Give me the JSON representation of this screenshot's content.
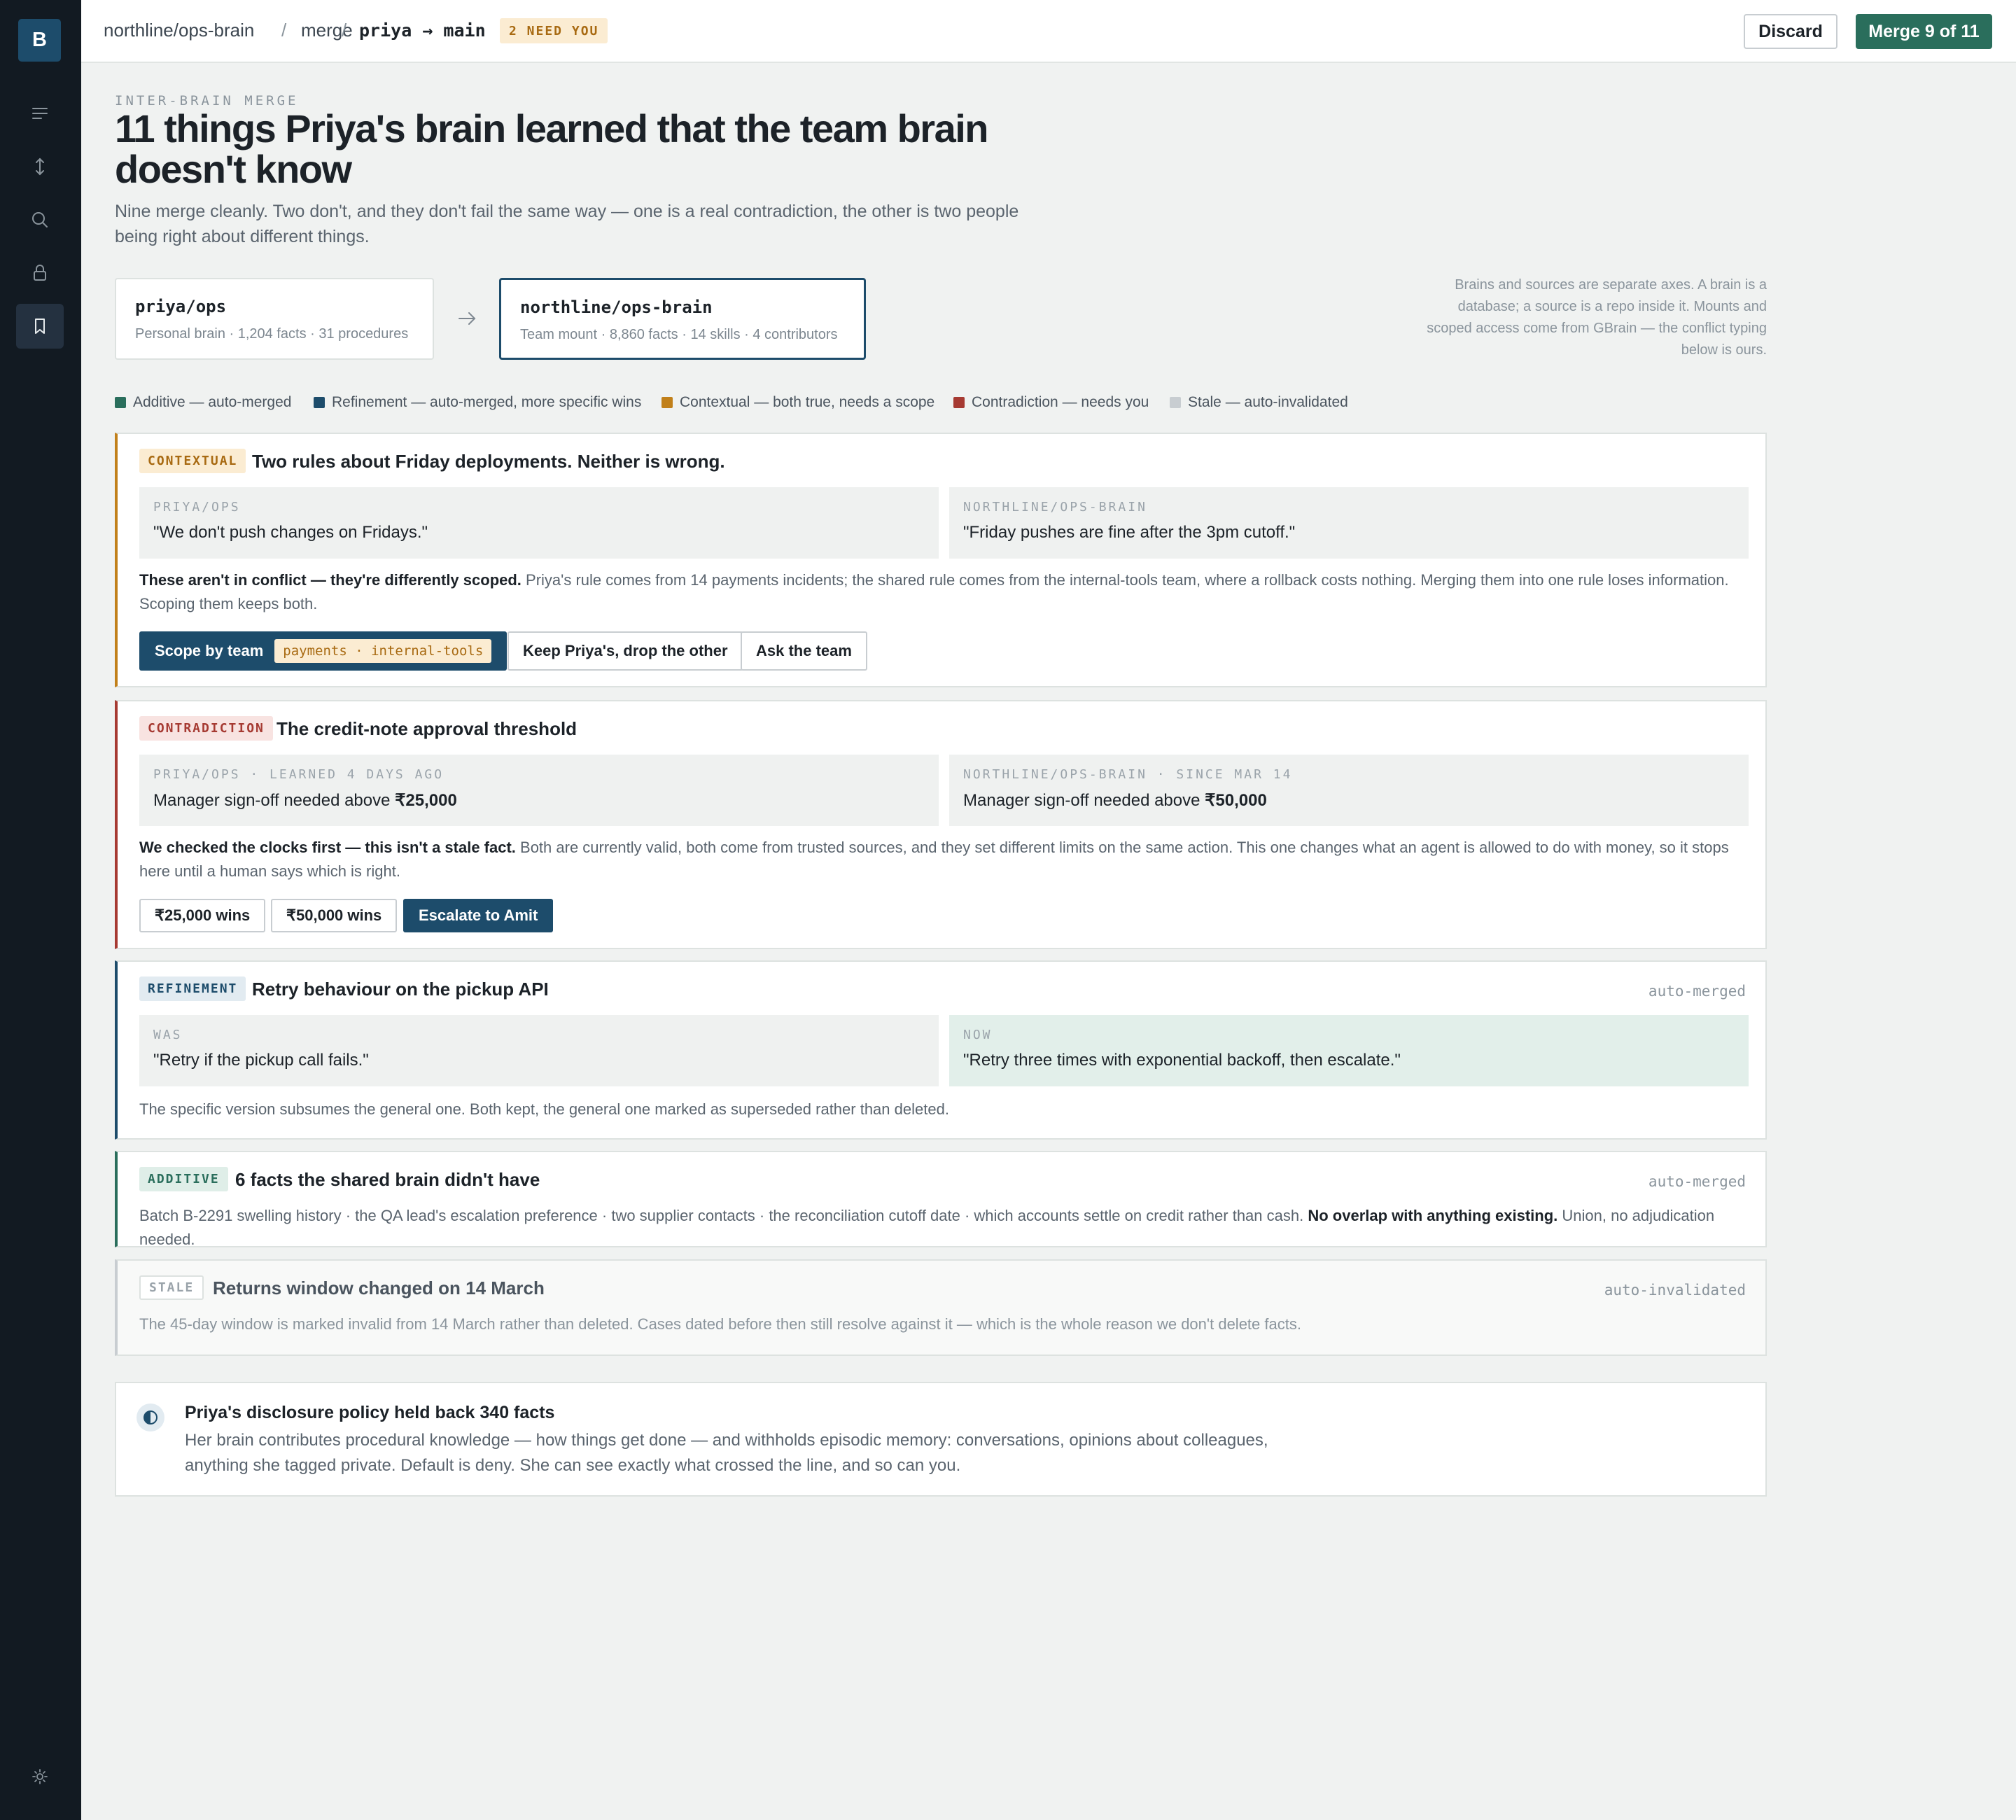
{
  "app": {
    "logo_letter": "B"
  },
  "sidebar": {
    "items": [
      {
        "icon": "list-icon",
        "active": false
      },
      {
        "icon": "merge-arrows-icon",
        "active": false
      },
      {
        "icon": "search-icon",
        "active": false
      },
      {
        "icon": "lock-icon",
        "active": false
      },
      {
        "icon": "bookmark-icon",
        "active": true
      }
    ],
    "footer_icon": "settings-sun-icon"
  },
  "topbar": {
    "breadcrumb": [
      "northline/ops-brain",
      "merge"
    ],
    "separator": "/",
    "branch": "priya → main",
    "badge": "2 NEED YOU",
    "discard_label": "Discard",
    "merge_label": "Merge 9 of 11"
  },
  "header": {
    "eyebrow": "INTER-BRAIN MERGE",
    "title": "11 things Priya's brain learned that the team brain doesn't know",
    "subtitle": "Nine merge cleanly. Two don't, and they don't fail the same way — one is a real contradiction, the other is two people being right about different things."
  },
  "brains": {
    "source": {
      "name": "priya/ops",
      "meta": "Personal brain · 1,204 facts · 31 procedures"
    },
    "target": {
      "name": "northline/ops-brain",
      "meta": "Team mount · 8,860 facts · 14 skills · 4 contributors"
    },
    "note": "Brains and sources are separate axes. A brain is a database; a source is a repo inside it. Mounts and scoped access come from GBrain — the conflict typing below is ours."
  },
  "legend": [
    {
      "label": "Additive — auto-merged",
      "color": "#2a6e5c"
    },
    {
      "label": "Refinement — auto-merged, more specific wins",
      "color": "#1d4c6b"
    },
    {
      "label": "Contextual — both true, needs a scope",
      "color": "#c1801a"
    },
    {
      "label": "Contradiction — needs you",
      "color": "#a63a32"
    },
    {
      "label": "Stale — auto-invalidated",
      "color": "#c8cdd1"
    }
  ],
  "cards": {
    "contextual": {
      "tag": "CONTEXTUAL",
      "title": "Two rules about Friday deployments. Neither is wrong.",
      "left_label": "PRIYA/OPS",
      "left_text": "\"We don't push changes on Fridays.\"",
      "right_label": "NORTHLINE/OPS-BRAIN",
      "right_text": "\"Friday pushes are fine after the 3pm cutoff.\"",
      "body_strong": "These aren't in conflict — they're differently scoped.",
      "body": " Priya's rule comes from 14 payments incidents; the shared rule comes from the internal-tools team, where a rollback costs nothing. Merging them into one rule loses information. Scoping them keeps both.",
      "action_primary": "Scope by team",
      "action_chip": "payments · internal-tools",
      "action_2": "Keep Priya's, drop the other",
      "action_3": "Ask the team"
    },
    "contradiction": {
      "tag": "CONTRADICTION",
      "title": "The credit-note approval threshold",
      "left_label": "PRIYA/OPS · LEARNED 4 DAYS AGO",
      "left_text": "Manager sign-off needed above ",
      "left_value": "₹25,000",
      "right_label": "NORTHLINE/OPS-BRAIN · SINCE MAR 14",
      "right_text": "Manager sign-off needed above ",
      "right_value": "₹50,000",
      "body_strong": "We checked the clocks first — this isn't a stale fact.",
      "body": " Both are currently valid, both come from trusted sources, and they set different limits on the same action. This one changes what an agent is allowed to do with money, so it stops here until a human says which is right.",
      "action_1": "₹25,000 wins",
      "action_2": "₹50,000 wins",
      "action_3": "Escalate to Amit"
    },
    "refinement": {
      "tag": "REFINEMENT",
      "title": "Retry behaviour on the pickup API",
      "status": "auto-merged",
      "left_label": "WAS",
      "left_text": "\"Retry if the pickup call fails.\"",
      "right_label": "NOW",
      "right_text": "\"Retry three times with exponential backoff, then escalate.\"",
      "body": "The specific version subsumes the general one. Both kept, the general one marked as superseded rather than deleted."
    },
    "additive": {
      "tag": "ADDITIVE",
      "title": "6 facts the shared brain didn't have",
      "status": "auto-merged",
      "body": "Batch B-2291 swelling history · the QA lead's escalation preference · two supplier contacts · the reconciliation cutoff date · which accounts settle on credit rather than cash. ",
      "body_strong": "No overlap with anything existing.",
      "body_tail": " Union, no adjudication needed."
    },
    "stale": {
      "tag": "STALE",
      "title": "Returns window changed on 14 March",
      "status": "auto-invalidated",
      "body": "The 45-day window is marked invalid from 14 March rather than deleted. Cases dated before then still resolve against it — which is the whole reason we don't delete facts."
    }
  },
  "disclosure": {
    "title": "Priya's disclosure policy held back 340 facts",
    "text": "Her brain contributes procedural knowledge — how things get done — and withholds episodic memory: conversations, opinions about colleagues, anything she tagged private. Default is deny. She can see exactly what crossed the line, and so can you."
  },
  "colors": {
    "brand": "#1d4c6b",
    "merge": "#2a6e5c",
    "contextual": "#c1801a",
    "contradiction": "#a63a32",
    "stale": "#c8cdd1"
  }
}
